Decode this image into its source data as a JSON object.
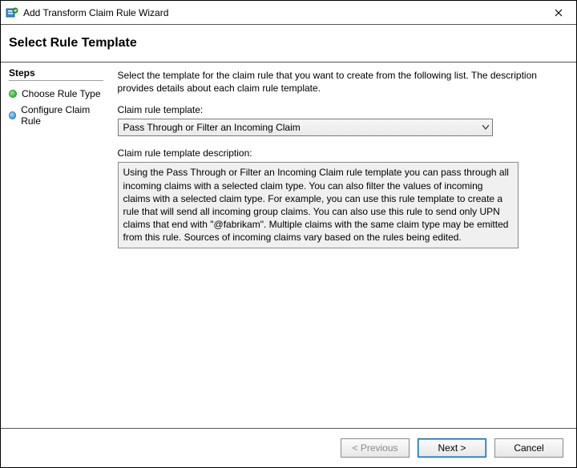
{
  "window": {
    "title": "Add Transform Claim Rule Wizard"
  },
  "header": {
    "title": "Select Rule Template"
  },
  "sidebar": {
    "title": "Steps",
    "items": [
      {
        "label": "Choose Rule Type",
        "state": "active"
      },
      {
        "label": "Configure Claim Rule",
        "state": "pending"
      }
    ]
  },
  "content": {
    "intro": "Select the template for the claim rule that you want to create from the following list. The description provides details about each claim rule template.",
    "template_label": "Claim rule template:",
    "template_selected": "Pass Through or Filter an Incoming Claim",
    "description_label": "Claim rule template description:",
    "description_text": "Using the Pass Through or Filter an Incoming Claim rule template you can pass through all incoming claims with a selected claim type.  You can also filter the values of incoming claims with a selected claim type.  For example, you can use this rule template to create a rule that will send all incoming group claims.  You can also use this rule to send only UPN claims that end with \"@fabrikam\".  Multiple claims with the same claim type may be emitted from this rule.  Sources of incoming claims vary based on the rules being edited."
  },
  "footer": {
    "previous": "< Previous",
    "next": "Next >",
    "cancel": "Cancel"
  }
}
